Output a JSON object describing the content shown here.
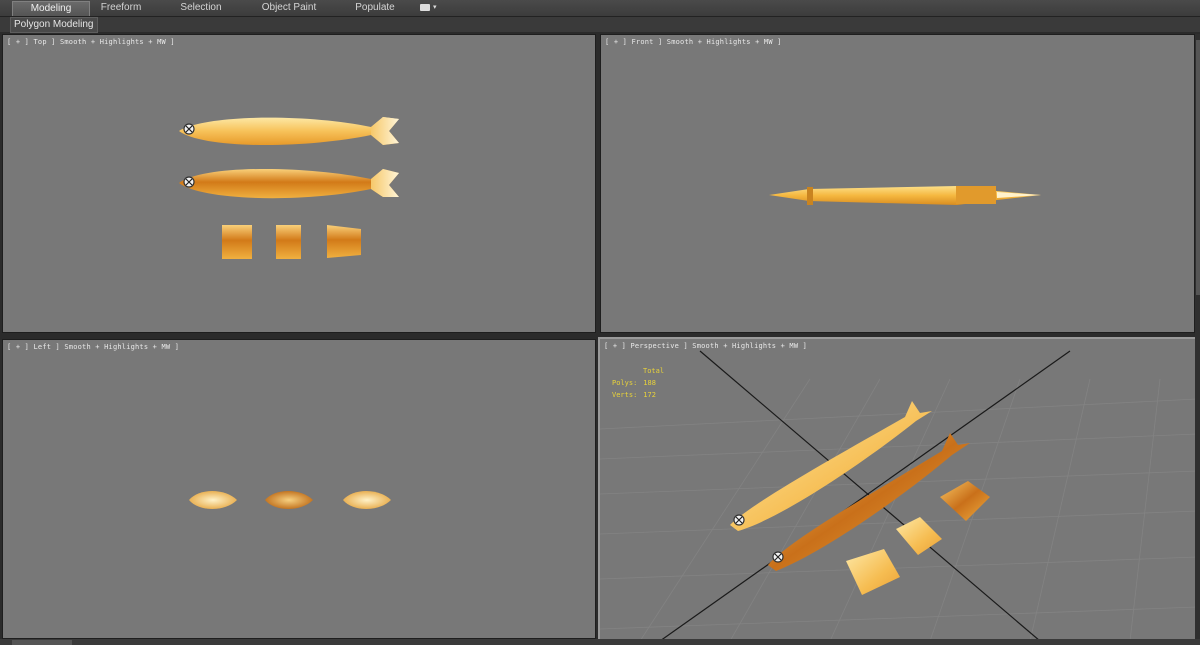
{
  "ribbon": {
    "tabs": [
      {
        "label": "Modeling"
      },
      {
        "label": "Freeform"
      },
      {
        "label": "Selection"
      },
      {
        "label": "Object Paint"
      },
      {
        "label": "Populate"
      }
    ],
    "sub_tab": "Polygon Modeling"
  },
  "viewports": {
    "top": {
      "label": "[ + ] Top ] Smooth + Highlights + MW ]"
    },
    "front": {
      "label": "[ + ] Front ] Smooth + Highlights + MW ]"
    },
    "left": {
      "label": "[ + ] Left ] Smooth + Highlights + MW ]"
    },
    "perspective": {
      "label": "[ + ] Perspective ] Smooth + Highlights + MW ]",
      "stats": {
        "header": "Total",
        "polys_label": "Polys:",
        "polys_value": "188",
        "verts_label": "Verts:",
        "verts_value": "172"
      }
    }
  },
  "colors": {
    "viewport_bg": "#787878",
    "fish_light": "#fbd77a",
    "fish_dark": "#c96d10",
    "stats_text": "#e8d23a"
  }
}
